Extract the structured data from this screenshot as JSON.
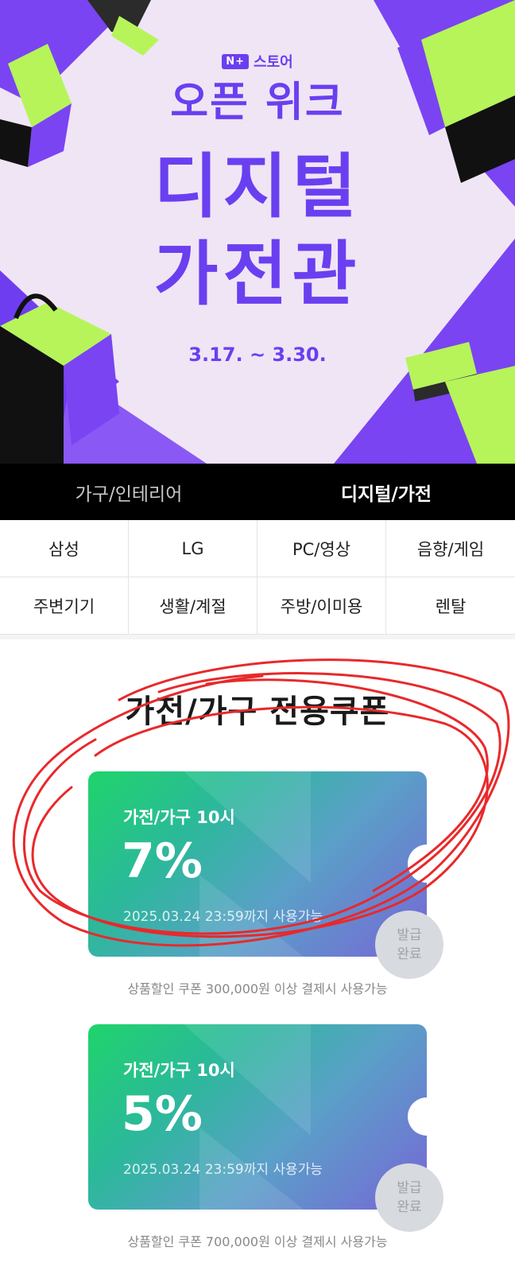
{
  "hero": {
    "badge": "N+",
    "store": "스토어",
    "event": "오픈 위크",
    "title_line1": "디지털",
    "title_line2": "가전관",
    "date": "3.17. ~ 3.30."
  },
  "tabs": [
    {
      "label": "가구/인테리어",
      "active": false
    },
    {
      "label": "디지털/가전",
      "active": true
    }
  ],
  "categories": [
    "삼성",
    "LG",
    "PC/영상",
    "음향/게임",
    "주변기기",
    "생활/계절",
    "주방/이미용",
    "렌탈"
  ],
  "coupon_section": {
    "title": "가전/가구 전용쿠폰",
    "coupons": [
      {
        "label": "가전/가구 10시",
        "value": "7%",
        "expire": "2025.03.24 23:59까지 사용가능",
        "status_line1": "발급",
        "status_line2": "완료",
        "condition": "상품할인 쿠폰 300,000원 이상 결제시 사용가능"
      },
      {
        "label": "가전/가구 10시",
        "value": "5%",
        "expire": "2025.03.24 23:59까지 사용가능",
        "status_line1": "발급",
        "status_line2": "완료",
        "condition": "상품할인 쿠폰 700,000원 이상 결제시 사용가능"
      }
    ]
  },
  "colors": {
    "brand_purple": "#6a3ff0",
    "hero_bg": "#f0e5f5",
    "accent_green": "#b6f45a",
    "tab_bg": "#000000",
    "annotation_red": "#e8292b"
  },
  "icons": [
    "lipstick-icon",
    "shopping-bag-icon",
    "gift-box-icon",
    "perfume-bottle-icon"
  ]
}
